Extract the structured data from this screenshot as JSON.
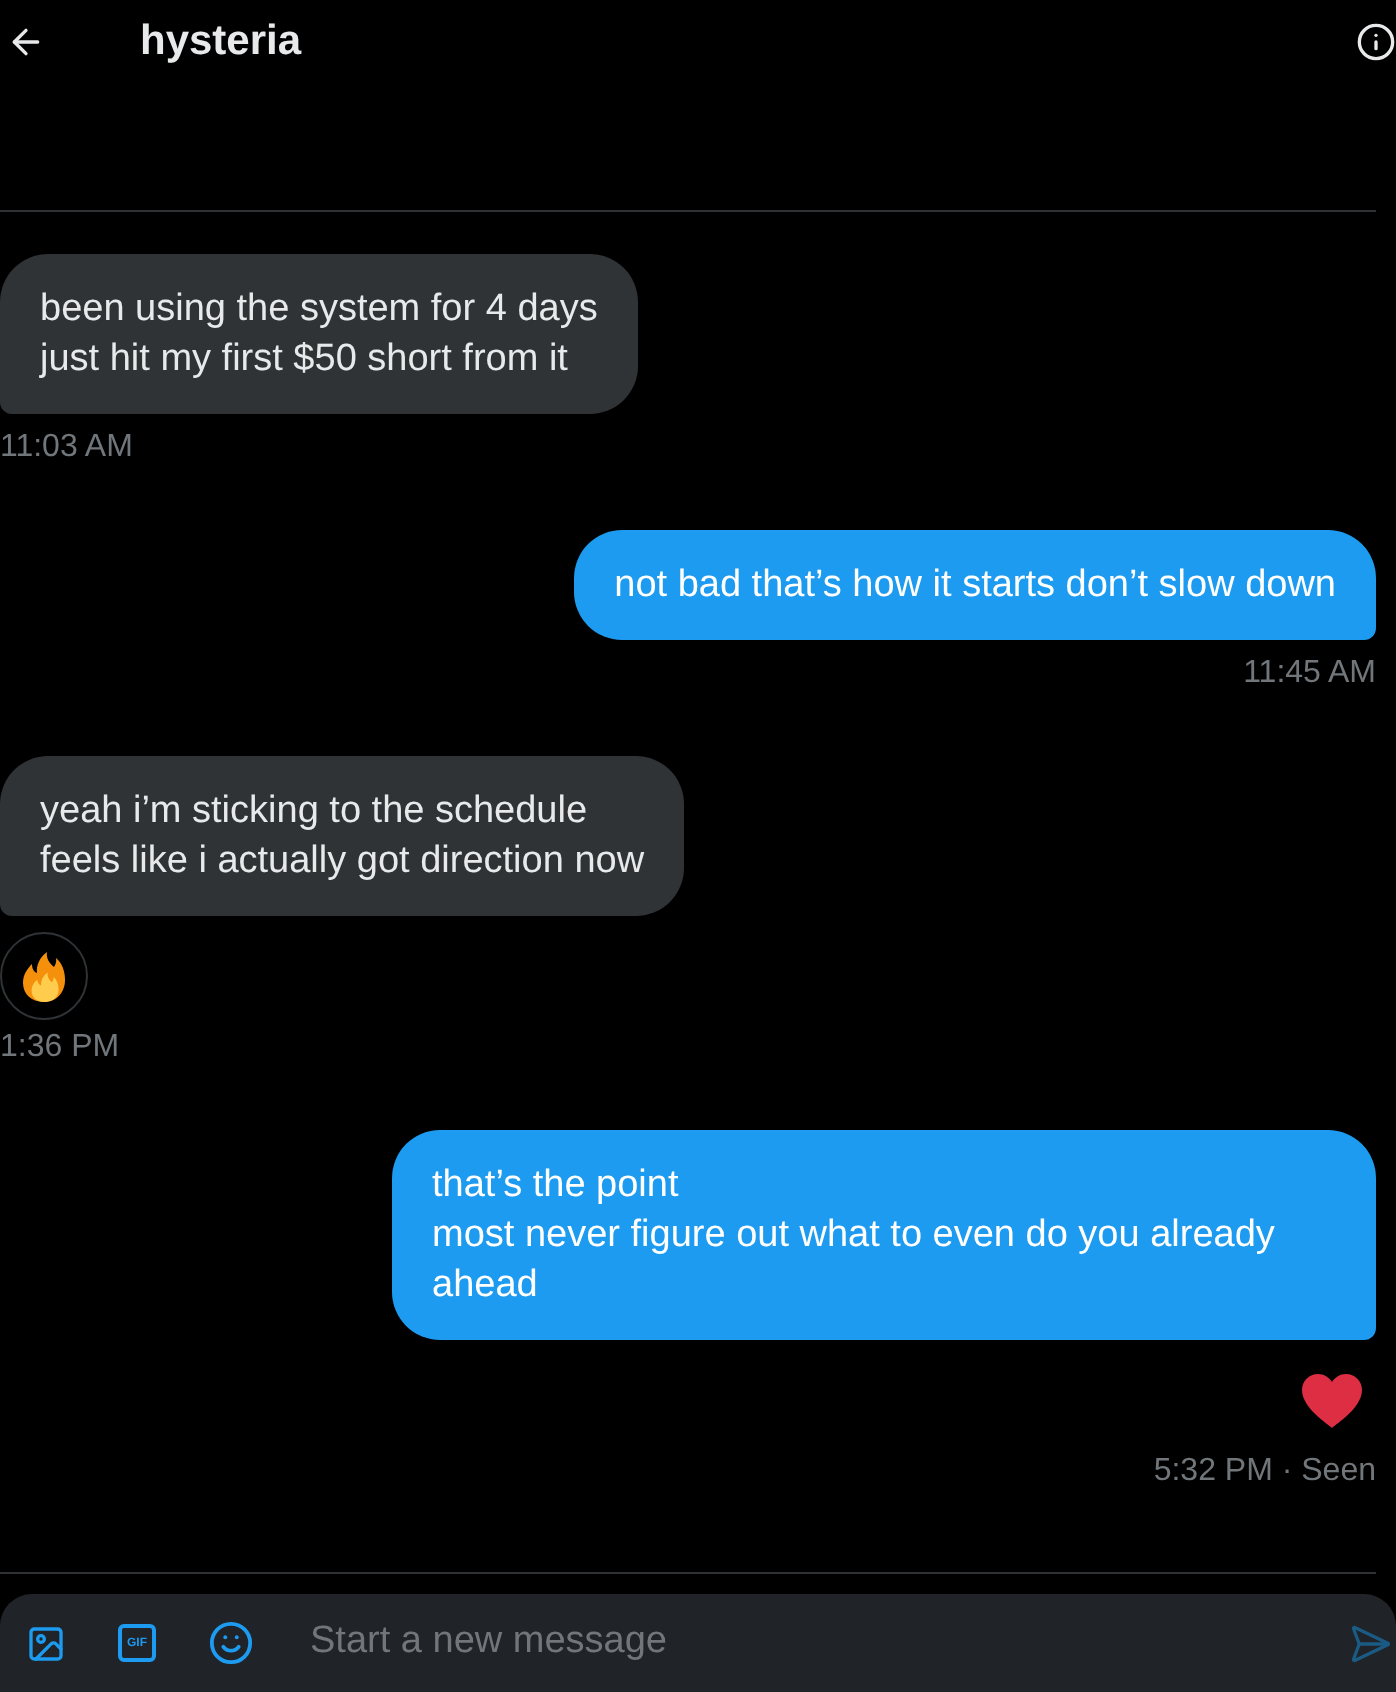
{
  "header": {
    "title": "hysteria"
  },
  "messages": [
    {
      "sent": false,
      "text": "been using the system for 4 days\njust hit my first $50 short from it",
      "time": "11:03 AM"
    },
    {
      "sent": true,
      "text": "not bad that’s how it starts don’t slow down",
      "time": "11:45 AM"
    },
    {
      "sent": false,
      "text": "yeah i’m sticking to the schedule\nfeels like i actually got direction now",
      "reaction": {
        "kind": "fire"
      },
      "time": "1:36 PM"
    },
    {
      "sent": true,
      "text": "that’s the point\nmost never figure out what to even do you already ahead",
      "reaction": {
        "kind": "heart"
      },
      "time": "5:32 PM · Seen"
    }
  ],
  "composer": {
    "gif_label": "GIF",
    "placeholder": "Start a new message"
  }
}
